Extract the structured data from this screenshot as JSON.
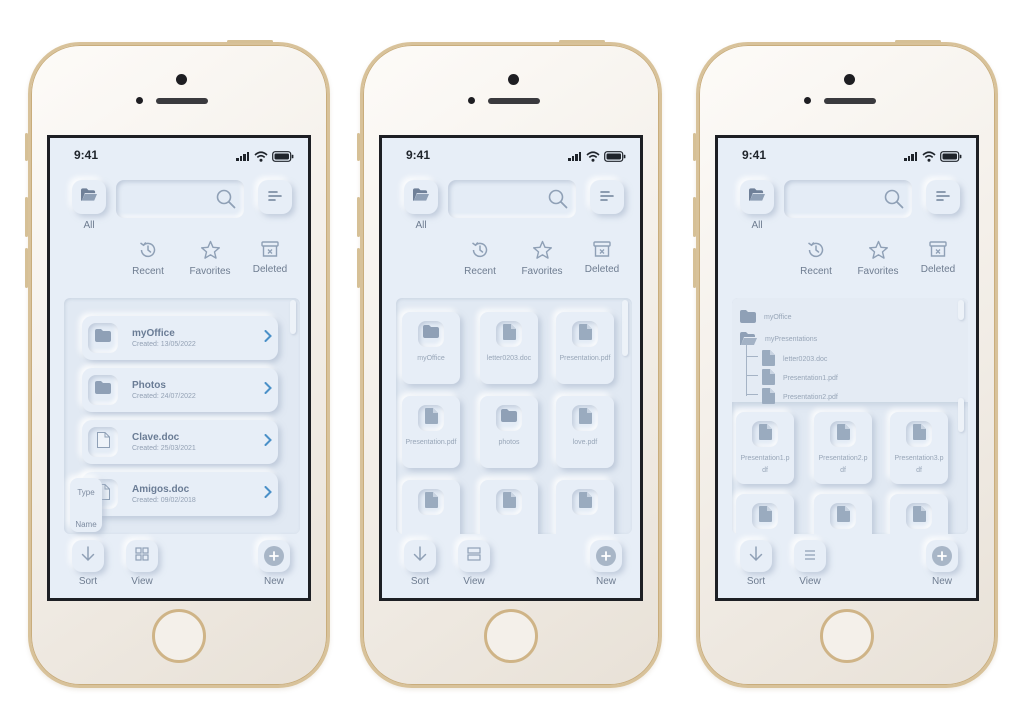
{
  "colors": {
    "accent": "#4a90c8",
    "icon": "#8fa0b6",
    "text_muted": "#6e7c90",
    "screen_bg": "#e7eef7",
    "frame_gold": "#d8c29a"
  },
  "status_bar": {
    "time": "9:41"
  },
  "header": {
    "all_label": "All"
  },
  "quick_filters": [
    {
      "label": "Recent",
      "icon": "history-icon"
    },
    {
      "label": "Favorites",
      "icon": "star-icon"
    },
    {
      "label": "Deleted",
      "icon": "trash-icon"
    }
  ],
  "phone1": {
    "files": [
      {
        "name": "myOffice",
        "date": "Created: 13/05/2022",
        "icon": "folder-icon"
      },
      {
        "name": "Photos",
        "date": "Created: 24/07/2022",
        "icon": "folder-icon"
      },
      {
        "name": "Clave.doc",
        "date": "Created: 25/03/2021",
        "icon": "document-icon"
      },
      {
        "name": "Amigos.doc",
        "date": "Created: 09/02/2018",
        "icon": "document-icon"
      }
    ],
    "sort_menu": {
      "type": "Type",
      "name": "Name"
    }
  },
  "phone2": {
    "tiles": [
      {
        "label": "myOffice",
        "icon": "folder-icon"
      },
      {
        "label": "letter0203.doc",
        "icon": "document-icon"
      },
      {
        "label": "Presentation.pdf",
        "icon": "document-icon"
      },
      {
        "label": "Presentation.pdf",
        "icon": "document-icon"
      },
      {
        "label": "photos",
        "icon": "folder-icon"
      },
      {
        "label": "love.pdf",
        "icon": "document-icon"
      },
      {
        "label": "",
        "icon": "document-icon"
      },
      {
        "label": "",
        "icon": "document-icon"
      },
      {
        "label": "",
        "icon": "document-icon"
      }
    ]
  },
  "phone3": {
    "tree": [
      {
        "label": "myOffice",
        "icon": "folder-icon"
      },
      {
        "label": "myPresentations",
        "icon": "folder-open-icon"
      },
      {
        "label": "letter0203.doc",
        "icon": "document-icon"
      },
      {
        "label": "Presentation1.pdf",
        "icon": "document-icon"
      },
      {
        "label": "Presentation2.pdf",
        "icon": "document-icon"
      }
    ],
    "tiles": [
      {
        "label": "Presentation1.pdf",
        "icon": "document-icon"
      },
      {
        "label": "Presentation2.pdf",
        "icon": "document-icon"
      },
      {
        "label": "Presentation3.pdf",
        "icon": "document-icon"
      },
      {
        "label": "",
        "icon": "document-icon"
      },
      {
        "label": "",
        "icon": "document-icon"
      },
      {
        "label": "",
        "icon": "document-icon"
      }
    ]
  },
  "bottom_bar": {
    "sort_label": "Sort",
    "view_label": "View",
    "new_label": "New"
  }
}
